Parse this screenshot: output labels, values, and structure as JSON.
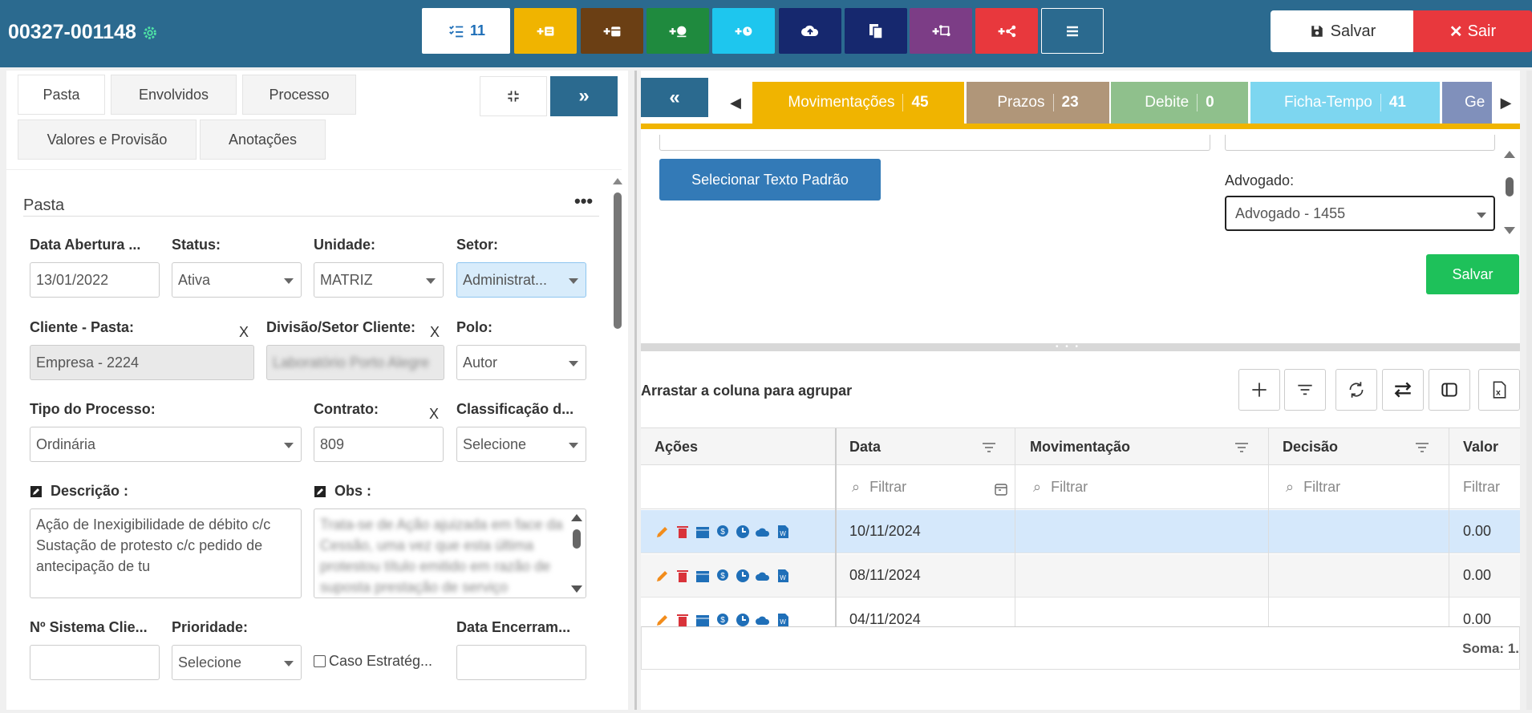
{
  "header": {
    "process_id": "00327-001148",
    "toolbar_count": "11",
    "save_label": "Salvar",
    "exit_label": "Sair"
  },
  "colors": {
    "header_bg": "#2b6a8f",
    "yellow": "#f0b400",
    "brown": "#6b3f14",
    "green": "#1f8a3e",
    "cyan": "#1ec6ee",
    "navy": "#16286e",
    "purple": "#7c3d86",
    "red": "#e8383d"
  },
  "left_tabs": [
    "Pasta",
    "Envolvidos",
    "Processo",
    "Valores e Provisão",
    "Anotações"
  ],
  "pasta": {
    "title": "Pasta",
    "menu_icon": "more-horizontal-icon",
    "data_abertura_label": "Data Abertura ...",
    "data_abertura_value": "13/01/2022",
    "status_label": "Status:",
    "status_value": "Ativa",
    "unidade_label": "Unidade:",
    "unidade_value": "MATRIZ",
    "setor_label": "Setor:",
    "setor_value": "Administrat...",
    "cliente_label": "Cliente - Pasta:",
    "cliente_value": "Empresa - 2224",
    "divisao_label": "Divisão/Setor Cliente:",
    "divisao_value": "Laboratório Porto Alegre",
    "polo_label": "Polo:",
    "polo_value": "Autor",
    "tipo_label": "Tipo do Processo:",
    "tipo_value": "Ordinária",
    "contrato_label": "Contrato:",
    "contrato_value": "809",
    "classificacao_label": "Classificação d...",
    "classificacao_value": "Selecione",
    "descricao_label": "Descrição :",
    "descricao_value": "Ação de Inexigibilidade de débito c/c Sustação de protesto c/c pedido de antecipação de tu",
    "obs_label": "Obs :",
    "obs_value": "Trata-se de Ação ajuizada em face da Cessão, uma vez que esta última protestou título emitido em razão de suposta prestação de serviço",
    "sistema_label": "Nº Sistema Clie...",
    "sistema_value": "",
    "prioridade_label": "Prioridade:",
    "prioridade_value": "Selecione",
    "caso_label": "Caso Estratég...",
    "encerramento_label": "Data Encerram...",
    "encerramento_value": "",
    "x_mark": "X"
  },
  "right_tabs": [
    {
      "label": "Movimentações",
      "count": "45"
    },
    {
      "label": "Prazos",
      "count": "23"
    },
    {
      "label": "Debite",
      "count": "0"
    },
    {
      "label": "Ficha-Tempo",
      "count": "41"
    },
    {
      "label": "Ge",
      "count": ""
    }
  ],
  "editor": {
    "select_text_button": "Selecionar Texto Padrão",
    "advogado_label": "Advogado:",
    "advogado_value": "Advogado - 1455",
    "save_button": "Salvar"
  },
  "grid": {
    "group_hint": "Arrastar a coluna para agrupar",
    "columns": [
      "Ações",
      "Data",
      "Movimentação",
      "Decisão",
      "Valor"
    ],
    "filter_placeholder": "Filtrar",
    "rows": [
      {
        "data": "10/11/2024",
        "movimentacao": "",
        "decisao": "",
        "valor": "0.00"
      },
      {
        "data": "08/11/2024",
        "movimentacao": "",
        "decisao": "",
        "valor": "0.00"
      },
      {
        "data": "04/11/2024",
        "movimentacao": "",
        "decisao": "",
        "valor": "0.00"
      }
    ],
    "sum_label": "Soma: 1."
  }
}
